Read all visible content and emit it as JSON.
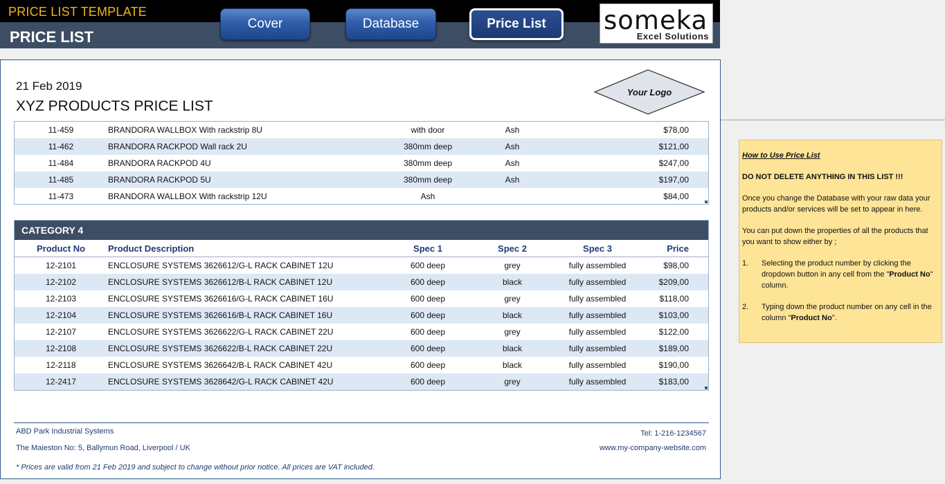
{
  "header": {
    "app_title": "PRICE LIST TEMPLATE",
    "page_title": "PRICE LIST",
    "nav": {
      "cover": "Cover",
      "database": "Database",
      "price_list": "Price List"
    },
    "logo": {
      "main": "someka",
      "sub": "Excel Solutions"
    }
  },
  "document": {
    "date": "21 Feb 2019",
    "title": "XYZ PRODUCTS PRICE LIST",
    "logo_placeholder": "Your Logo"
  },
  "table_prev": {
    "rows": [
      {
        "no": "11-459",
        "desc": "BRANDORA WALLBOX With rackstrip 8U",
        "spec1": "with door",
        "spec2": "Ash",
        "spec3": "",
        "price": "$78,00"
      },
      {
        "no": "11-462",
        "desc": "BRANDORA RACKPOD Wall rack 2U",
        "spec1": "380mm deep",
        "spec2": "Ash",
        "spec3": "",
        "price": "$121,00"
      },
      {
        "no": "11-484",
        "desc": "BRANDORA RACKPOD 4U",
        "spec1": "380mm deep",
        "spec2": "Ash",
        "spec3": "",
        "price": "$247,00"
      },
      {
        "no": "11-485",
        "desc": "BRANDORA RACKPOD 5U",
        "spec1": "380mm deep",
        "spec2": "Ash",
        "spec3": "",
        "price": "$197,00"
      },
      {
        "no": "11-473",
        "desc": "BRANDORA WALLBOX With rackstrip 12U",
        "spec1": "Ash",
        "spec2": "",
        "spec3": "",
        "price": "$84,00"
      }
    ]
  },
  "category4": {
    "name": "CATEGORY 4",
    "columns": {
      "no": "Product No",
      "desc": "Product Description",
      "spec1": "Spec 1",
      "spec2": "Spec 2",
      "spec3": "Spec 3",
      "price": "Price"
    },
    "rows": [
      {
        "no": "12-2101",
        "desc": "ENCLOSURE SYSTEMS 3626612/G-L RACK CABINET 12U",
        "spec1": "600 deep",
        "spec2": "grey",
        "spec3": "fully assembled",
        "price": "$98,00"
      },
      {
        "no": "12-2102",
        "desc": "ENCLOSURE SYSTEMS 3626612/B-L RACK CABINET 12U",
        "spec1": "600 deep",
        "spec2": "black",
        "spec3": "fully assembled",
        "price": "$209,00"
      },
      {
        "no": "12-2103",
        "desc": "ENCLOSURE SYSTEMS 3626616/G-L RACK CABINET 16U",
        "spec1": "600 deep",
        "spec2": "grey",
        "spec3": "fully assembled",
        "price": "$118,00"
      },
      {
        "no": "12-2104",
        "desc": "ENCLOSURE SYSTEMS 3626616/B-L RACK CABINET 16U",
        "spec1": "600 deep",
        "spec2": "black",
        "spec3": "fully assembled",
        "price": "$103,00"
      },
      {
        "no": "12-2107",
        "desc": "ENCLOSURE SYSTEMS 3626622/G-L RACK CABINET 22U",
        "spec1": "600 deep",
        "spec2": "grey",
        "spec3": "fully assembled",
        "price": "$122,00"
      },
      {
        "no": "12-2108",
        "desc": "ENCLOSURE SYSTEMS 3626622/B-L RACK CABINET 22U",
        "spec1": "600 deep",
        "spec2": "black",
        "spec3": "fully assembled",
        "price": "$189,00"
      },
      {
        "no": "12-2118",
        "desc": "ENCLOSURE SYSTEMS 3626642/B-L RACK CABINET 42U",
        "spec1": "600 deep",
        "spec2": "black",
        "spec3": "fully assembled",
        "price": "$190,00"
      },
      {
        "no": "12-2417",
        "desc": "ENCLOSURE SYSTEMS 3628642/G-L RACK CABINET 42U",
        "spec1": "600 deep",
        "spec2": "grey",
        "spec3": "fully assembled",
        "price": "$183,00"
      }
    ]
  },
  "footer": {
    "company": "ABD Park Industrial Systems",
    "address": "The Maieston No: 5, Ballymun Road, Liverpool / UK",
    "tel": "Tel: 1-216-1234567",
    "website": "www.my-company-website.com",
    "note": "* Prices are valid from 21 Feb 2019 and subject to change without prior notice. All prices are VAT included."
  },
  "howto": {
    "title": "How to Use Price List",
    "warning": "DO NOT DELETE ANYTHING IN THIS LIST !!!",
    "intro": "Once you change the Database with your raw data your products and/or services will be set to appear in here.",
    "props": "You can put down the properties of all the products that you want to show either by ;",
    "step1": {
      "num": "1.",
      "pre": "Selecting the product number by clicking the dropdown button in any cell from the \"",
      "bold": "Product No",
      "post": "\" column."
    },
    "step2": {
      "num": "2.",
      "pre": "Typing down the product number on any cell in the column \"",
      "bold": "Product No",
      "post": "\"."
    }
  },
  "colors": {
    "header_dark": "#3d4d63",
    "accent_orange": "#f5b21f",
    "row_alt": "#dde8f5",
    "note_bg": "#fde497",
    "button_blue": "#2f5eaa"
  }
}
